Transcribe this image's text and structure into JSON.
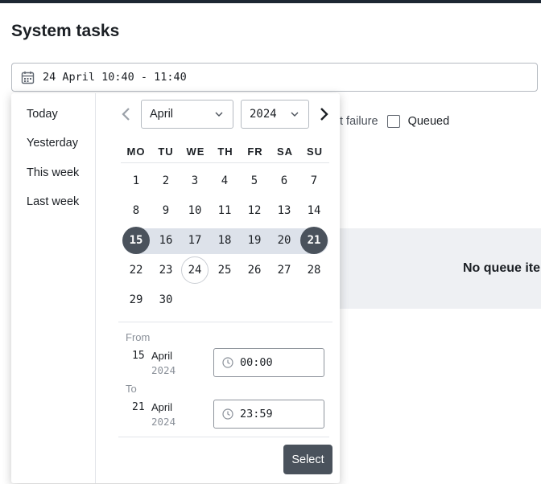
{
  "page": {
    "title": "System tasks"
  },
  "date_range_input": {
    "value": "24 April 10:40 - 11:40"
  },
  "filters": {
    "partial_label": "t failure",
    "queued_label": "Queued"
  },
  "queue": {
    "empty_text": "No queue ite"
  },
  "datepicker": {
    "shortcuts": [
      "Today",
      "Yesterday",
      "This week",
      "Last week"
    ],
    "month_select": "April",
    "year_select": "2024",
    "weekdays": [
      "MO",
      "TU",
      "WE",
      "TH",
      "FR",
      "SA",
      "SU"
    ],
    "days": [
      "1",
      "2",
      "3",
      "4",
      "5",
      "6",
      "7",
      "8",
      "9",
      "10",
      "11",
      "12",
      "13",
      "14",
      "15",
      "16",
      "17",
      "18",
      "19",
      "20",
      "21",
      "22",
      "23",
      "24",
      "25",
      "26",
      "27",
      "28",
      "29",
      "30"
    ],
    "range_start_day": 15,
    "range_end_day": 21,
    "today_day": 24,
    "from": {
      "label": "From",
      "day": "15",
      "month": "April",
      "year": "2024",
      "time": "00:00"
    },
    "to": {
      "label": "To",
      "day": "21",
      "month": "April",
      "year": "2024",
      "time": "23:59"
    },
    "select_button": "Select"
  },
  "colors": {
    "accent_dark": "#4a525c",
    "range_band": "#dde2ea",
    "empty_panel": "#eef0f3"
  }
}
